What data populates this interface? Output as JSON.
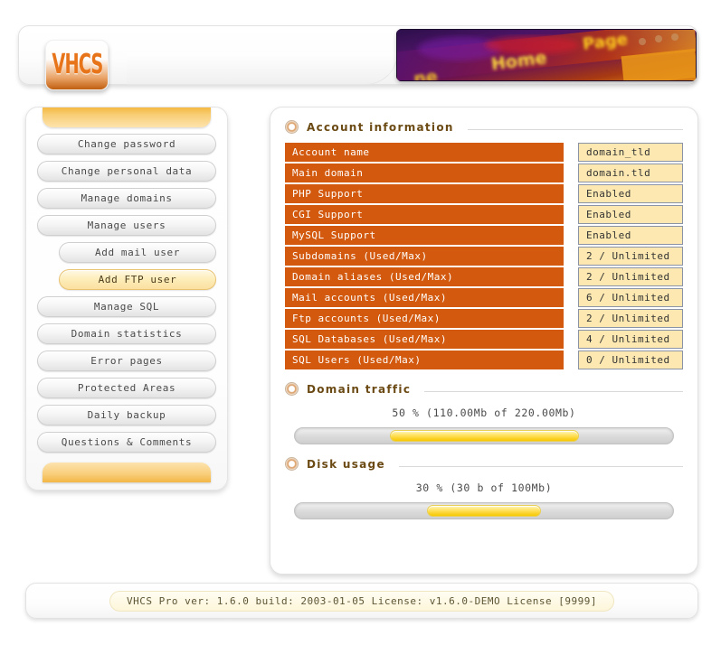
{
  "header": {
    "logo_text": "VHCS",
    "banner_alt": "neon-home-page-sign"
  },
  "sidebar": {
    "items": [
      {
        "label": "Change password",
        "indent": false,
        "active": false
      },
      {
        "label": "Change personal data",
        "indent": false,
        "active": false
      },
      {
        "label": "Manage domains",
        "indent": false,
        "active": false
      },
      {
        "label": "Manage users",
        "indent": false,
        "active": false
      },
      {
        "label": "Add mail user",
        "indent": true,
        "active": false
      },
      {
        "label": "Add FTP user",
        "indent": true,
        "active": true
      },
      {
        "label": "Manage SQL",
        "indent": false,
        "active": false
      },
      {
        "label": "Domain statistics",
        "indent": false,
        "active": false
      },
      {
        "label": "Error pages",
        "indent": false,
        "active": false
      },
      {
        "label": "Protected Areas",
        "indent": false,
        "active": false
      },
      {
        "label": "Daily backup",
        "indent": false,
        "active": false
      },
      {
        "label": "Questions & Comments",
        "indent": false,
        "active": false
      }
    ]
  },
  "main": {
    "account_section": {
      "title": "Account information",
      "rows": [
        {
          "label": "Account name",
          "value": "domain_tld"
        },
        {
          "label": "Main domain",
          "value": "domain.tld"
        },
        {
          "label": "PHP Support",
          "value": "Enabled"
        },
        {
          "label": "CGI Support",
          "value": "Enabled"
        },
        {
          "label": "MySQL Support",
          "value": "Enabled"
        },
        {
          "label": "Subdomains (Used/Max)",
          "value": "2 / Unlimited"
        },
        {
          "label": "Domain aliases (Used/Max)",
          "value": "2 / Unlimited"
        },
        {
          "label": "Mail accounts (Used/Max)",
          "value": "6 / Unlimited"
        },
        {
          "label": "Ftp accounts (Used/Max)",
          "value": "2 / Unlimited"
        },
        {
          "label": "SQL Databases (Used/Max)",
          "value": "4 / Unlimited"
        },
        {
          "label": "SQL Users (Used/Max)",
          "value": "0 / Unlimited"
        }
      ]
    },
    "traffic_section": {
      "title": "Domain traffic",
      "summary": "50 %  (110.00Mb of 220.00Mb)",
      "percent": 50
    },
    "disk_section": {
      "title": "Disk usage",
      "summary": "30 %  (30 b of 100Mb)",
      "percent": 30
    }
  },
  "footer": {
    "text": "VHCS Pro ver: 1.6.0 build: 2003-01-05 License: v1.6.0-DEMO License [9999]"
  },
  "colors": {
    "row_orange": "#d2590d",
    "value_cream": "#fce8b0",
    "accent_amber": "#f4b942",
    "title_brown": "#6b4a14"
  }
}
